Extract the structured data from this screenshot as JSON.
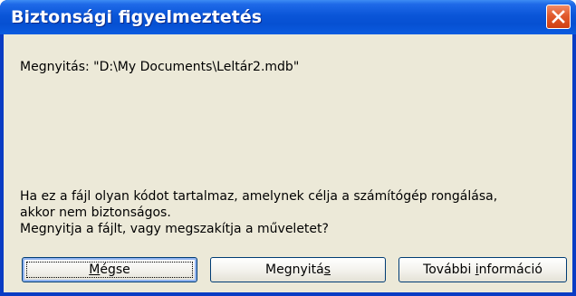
{
  "window": {
    "title": "Biztonsági figyelmeztetés",
    "colors": {
      "titlebar": "#0a55d8",
      "client": "#ece9d8",
      "close": "#e15a2c"
    }
  },
  "dialog": {
    "open_line": "Megnyitás: \"D:\\My Documents\\Leltár2.mdb\"",
    "warning_lines": [
      "Ha ez a fájl olyan kódot tartalmaz, amelynek célja a számítógép rongálása,",
      "akkor nem biztonságos.",
      "Megnyitja a fájlt, vagy megszakítja a műveletet?"
    ]
  },
  "buttons": {
    "cancel": {
      "prefix": "",
      "mnemonic": "M",
      "suffix": "égse"
    },
    "open": {
      "prefix": "Megnyitá",
      "mnemonic": "s",
      "suffix": ""
    },
    "more_info": {
      "prefix": "További ",
      "mnemonic": "i",
      "suffix": "nformáció"
    }
  },
  "icons": {
    "close": "close-icon"
  }
}
